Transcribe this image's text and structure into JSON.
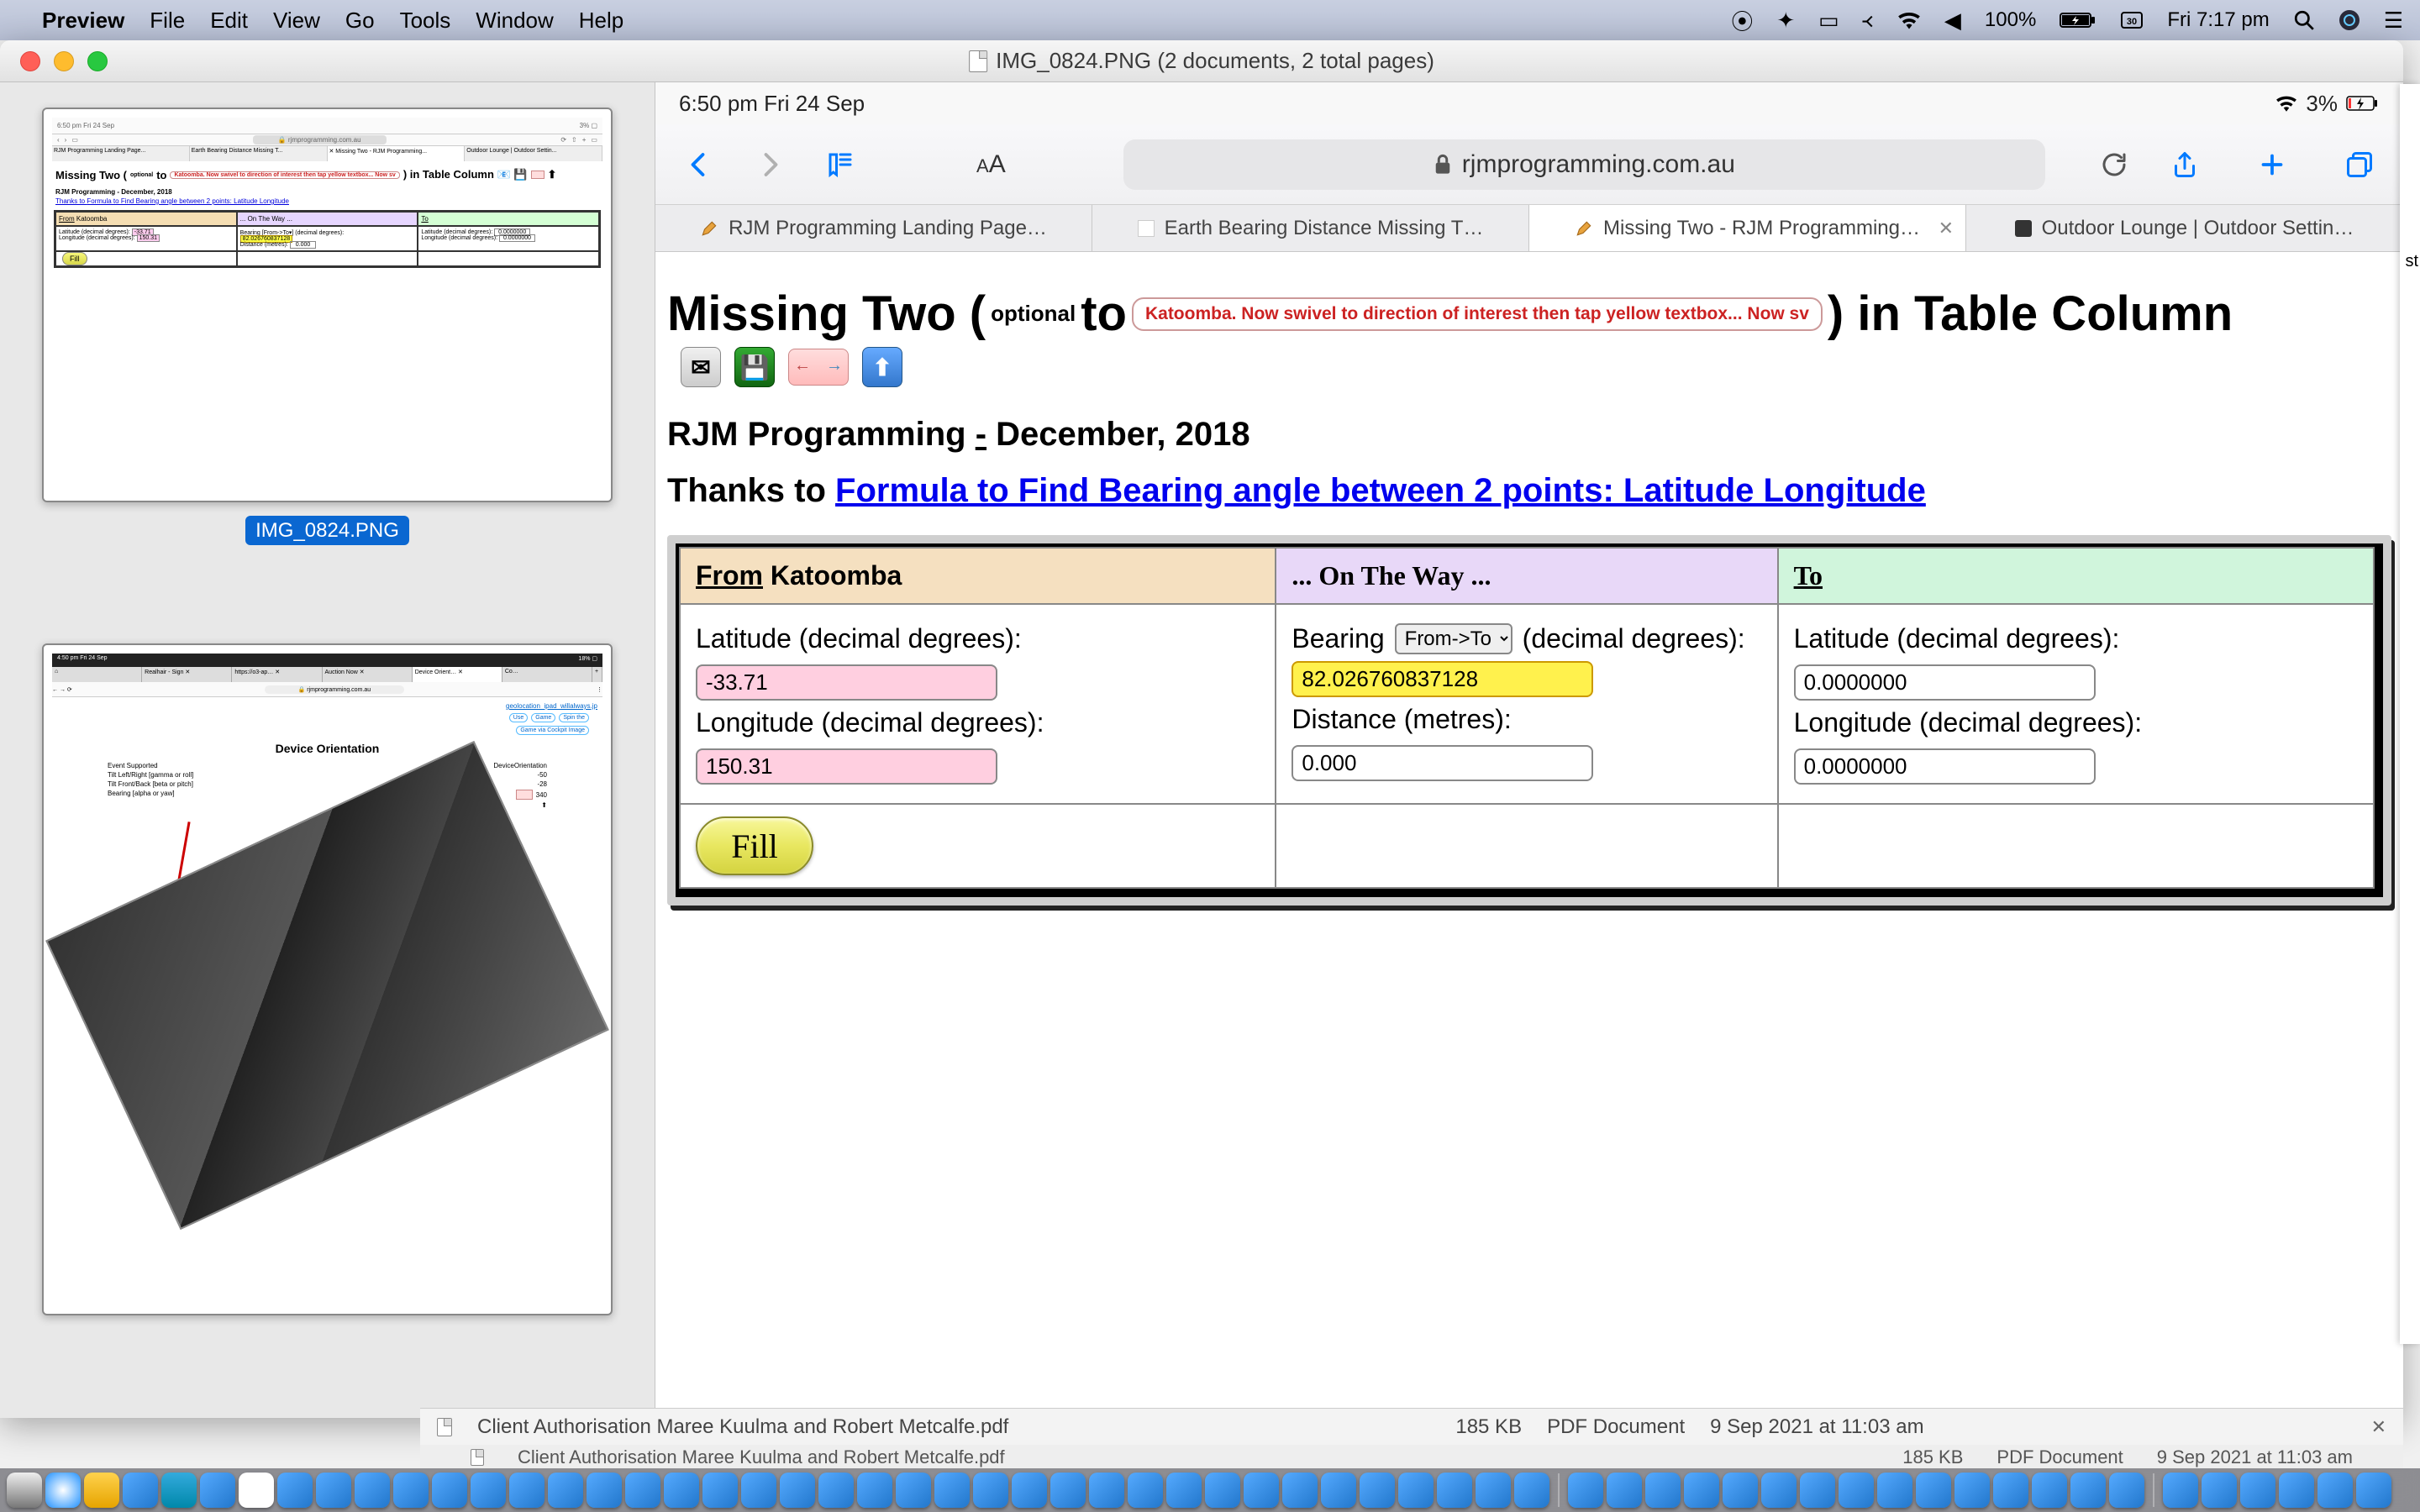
{
  "menubar": {
    "app": "Preview",
    "items": [
      "File",
      "Edit",
      "View",
      "Go",
      "Tools",
      "Window",
      "Help"
    ],
    "battery": "100%",
    "clock": "Fri 7:17 pm"
  },
  "window": {
    "title": "IMG_0824.PNG (2 documents, 2 total pages)"
  },
  "sidebar": {
    "thumb1_label": "IMG_0824.PNG",
    "thumb2": {
      "status_left": "4:50 pm  Fri 24 Sep",
      "status_right": "18% ▢",
      "tabs": [
        "Realhair - Sign",
        "https://o3-ap…",
        "Auction Now",
        "Device Orient…",
        "Co…"
      ],
      "url": "rjmprogramming.com.au",
      "heading": "Device Orientation",
      "rows": [
        [
          "Event Supported",
          "DeviceOrientation"
        ],
        [
          "Tilt Left/Right [gamma or roll]",
          "-50"
        ],
        [
          "Tilt Front/Back [beta or pitch]",
          "-28"
        ],
        [
          "Bearing [alpha or yaw]",
          "340"
        ]
      ],
      "buttons": [
        "Use",
        "Game",
        "Spin the"
      ],
      "button2": "Game via Cockpit Image",
      "jsfile": "geolocation_ipad_willalways.jp"
    }
  },
  "ipad": {
    "status_left": "6:50 pm   Fri 24 Sep",
    "status_right": "3%"
  },
  "safari": {
    "url": "rjmprogramming.com.au",
    "tabs": [
      {
        "label": "RJM Programming Landing Page…"
      },
      {
        "label": "Earth Bearing Distance Missing T…"
      },
      {
        "label": "Missing Two - RJM Programming…"
      },
      {
        "label": "Outdoor Lounge | Outdoor Settin…"
      }
    ]
  },
  "page": {
    "title_a": "Missing Two (",
    "title_sub": "optional",
    "title_b": " to ",
    "instr": "Katoomba.  Now swivel to direction of interest then tap yellow textbox...  Now sv",
    "title_c": ") in Table Column",
    "subhead_a": "RJM Programming ",
    "subhead_sep": "-",
    "subhead_b": " December, 2018",
    "thanks_label": "Thanks to ",
    "thanks_link": "Formula to Find Bearing angle between 2 points: Latitude Longitude"
  },
  "table": {
    "from_label": "From",
    "from_place": "  Katoomba",
    "otw": "... On The Way ...",
    "to": "To",
    "lat_label": "Latitude (decimal degrees): ",
    "lon_label": "Longitude (decimal degrees): ",
    "bearing_label": "Bearing ",
    "bearing_unit": " (decimal degrees):",
    "distance_label": "Distance (metres): ",
    "select_opt": "From->To",
    "from_lat": "-33.71",
    "from_lon": "150.31",
    "bearing_val": "82.026760837128",
    "distance_val": "0.000",
    "to_lat": "0.0000000",
    "to_lon": "0.0000000",
    "fill": "Fill"
  },
  "downloads": {
    "file1": "Client Authorisation Maree Kuulma and Robert Metcalfe.pdf",
    "size1": "185 KB",
    "type1": "PDF Document",
    "date1": "9 Sep 2021 at 11:03 am",
    "file2": "Client Authorisation Maree Kuulma and Robert Metcalfe.pdf",
    "size2": "185 KB",
    "type2": "PDF Document",
    "date2": "9 Sep 2021 at 11:03 am"
  },
  "right_peek": {
    "a": "st"
  }
}
